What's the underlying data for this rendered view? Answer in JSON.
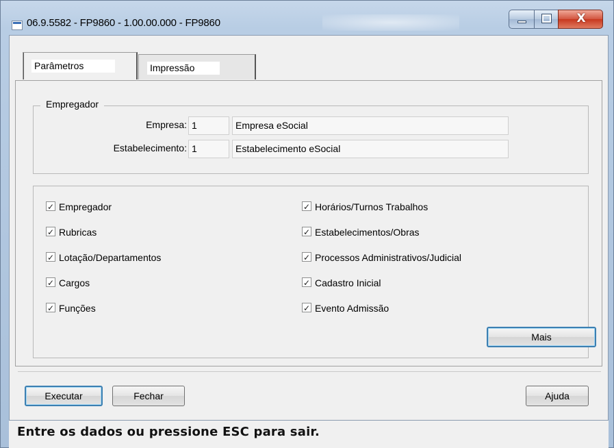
{
  "window": {
    "title": "06.9.5582 - FP9860 - 1.00.00.000 - FP9860",
    "close_glyph": "X"
  },
  "tabs": [
    {
      "label": "Parâmetros",
      "active": true
    },
    {
      "label": "Impressão",
      "active": false
    }
  ],
  "empregador_group": {
    "legend": "Empregador",
    "empresa_label": "Empresa:",
    "empresa_code": "1",
    "empresa_name": "Empresa eSocial",
    "estabelecimento_label": "Estabelecimento:",
    "estabelecimento_code": "1",
    "estabelecimento_name": "Estabelecimento eSocial"
  },
  "checkboxes": {
    "left": [
      {
        "label": "Empregador",
        "checked": true
      },
      {
        "label": "Rubricas",
        "checked": true
      },
      {
        "label": "Lotação/Departamentos",
        "checked": true
      },
      {
        "label": "Cargos",
        "checked": true
      },
      {
        "label": "Funções",
        "checked": true
      }
    ],
    "right": [
      {
        "label": "Horários/Turnos Trabalhos",
        "checked": true
      },
      {
        "label": "Estabelecimentos/Obras",
        "checked": true
      },
      {
        "label": "Processos Administrativos/Judicial",
        "checked": true
      },
      {
        "label": "Cadastro Inicial",
        "checked": true
      },
      {
        "label": "Evento Admissão",
        "checked": true
      }
    ]
  },
  "buttons": {
    "mais": "Mais",
    "executar": "Executar",
    "fechar": "Fechar",
    "ajuda": "Ajuda"
  },
  "status": "Entre os dados ou pressione ESC para sair.",
  "icons": {
    "app": "window-app-icon",
    "minimize": "minimize-icon",
    "maximize": "maximize-icon",
    "close": "close-icon"
  }
}
